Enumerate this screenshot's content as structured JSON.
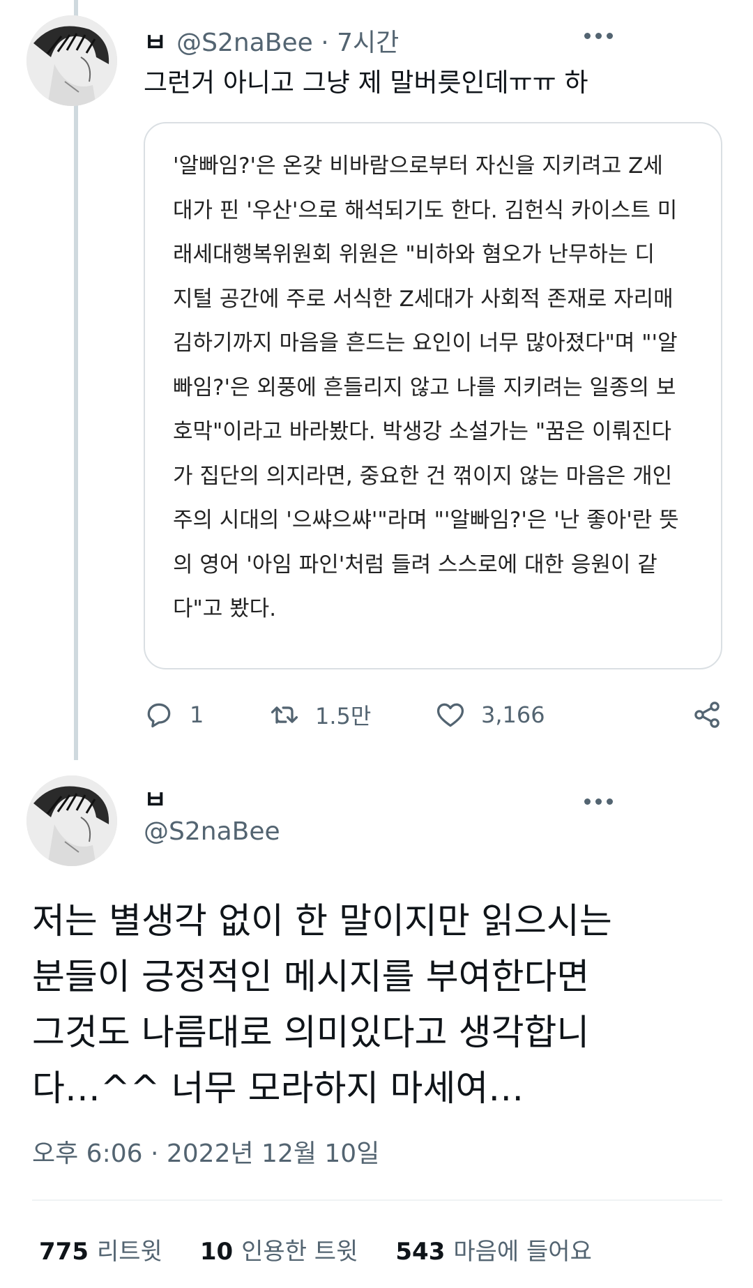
{
  "reply": {
    "name": "ㅂ",
    "handle": "@S2naBee",
    "separator": "·",
    "time_ago": "7시간",
    "text": "그런거 아니고 그냥 제 말버릇인데ㅠㅠ 하",
    "quote_lines": [
      "'알빠임?'은 온갖 비바람으로부터 자신을 지키려고 Z세",
      "대가 핀 '우산'으로 해석되기도 한다. 김헌식 카이스트 미",
      "래세대행복위원회 위원은 \"비하와 혐오가 난무하는 디",
      "지털 공간에 주로 서식한 Z세대가 사회적 존재로 자리매",
      "김하기까지 마음을 흔드는 요인이 너무 많아졌다\"며 \"'알",
      "빠임?'은 외풍에 흔들리지 않고 나를 지키려는 일종의 보",
      "호막\"이라고 바라봤다. 박생강 소설가는 \"꿈은 이뤄진다",
      "가 집단의 의지라면, 중요한 건 꺾이지 않는 마음은 개인",
      "주의 시대의 '으쌰으쌰'\"라며 \"'알빠임?'은 '난 좋아'란 뜻",
      "의 영어 '아임 파인'처럼 들려 스스로에 대한 응원이 같",
      "다\"고 봤다."
    ],
    "actions": {
      "reply_count": "1",
      "retweet_count": "1.5만",
      "like_count": "3,166"
    }
  },
  "main": {
    "name": "ㅂ",
    "handle": "@S2naBee",
    "text_lines": [
      "저는 별생각 없이 한 말이지만 읽으시는",
      "분들이 긍정적인 메시지를 부여한다면",
      "그것도 나름대로 의미있다고 생각합니",
      "다…^^ 너무 모라하지 마세여…"
    ],
    "timestamp": "오후 6:06 · 2022년 12월 10일",
    "stats": {
      "retweets_num": "775",
      "retweets_label": "리트윗",
      "quotes_num": "10",
      "quotes_label": "인용한 트윗",
      "likes_num": "543",
      "likes_label": "마음에 들어요"
    }
  },
  "colors": {
    "text": "#0f1419",
    "secondary": "#536471",
    "border": "#dadfe3",
    "thread_line": "#cfd9de"
  },
  "icons": [
    "more-icon",
    "reply-icon",
    "retweet-icon",
    "like-icon",
    "share-icon"
  ]
}
